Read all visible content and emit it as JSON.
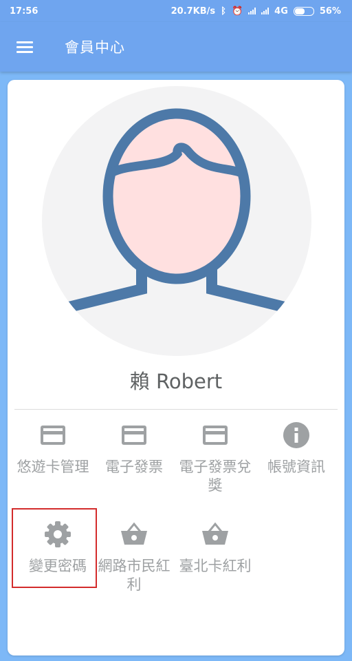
{
  "status_bar": {
    "time": "17:56",
    "speed": "20.7KB/s",
    "network": "4G",
    "battery": "56%",
    "battery_level": 0.56
  },
  "appbar": {
    "menu_icon": "menu-icon",
    "title": "會員中心"
  },
  "profile": {
    "name": "賴 Robert",
    "avatar": "person-avatar"
  },
  "menu_items": [
    {
      "label": "悠遊卡管理",
      "icon": "credit-card-icon"
    },
    {
      "label": "電子發票",
      "icon": "credit-card-icon"
    },
    {
      "label": "電子發票兌獎",
      "icon": "credit-card-icon"
    },
    {
      "label": "帳號資訊",
      "icon": "info-icon"
    },
    {
      "label": "變更密碼",
      "icon": "gear-icon"
    },
    {
      "label": "網路市民紅利",
      "icon": "basket-icon"
    },
    {
      "label": "臺北卡紅利",
      "icon": "basket-icon"
    }
  ],
  "colors": {
    "primary": "#6fa5ef",
    "background": "#7db8f7",
    "icon_gray": "#9ea1a3",
    "avatar_outline": "#4d79a8",
    "avatar_face": "#ffe0e0",
    "highlight": "#d32b2b"
  }
}
